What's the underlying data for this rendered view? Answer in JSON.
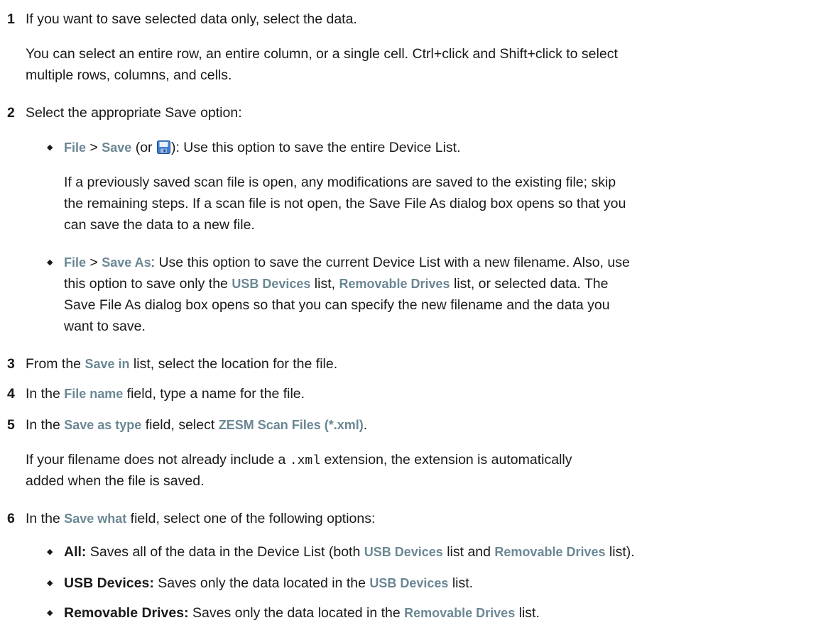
{
  "steps": [
    {
      "number": "1",
      "text": "If you want to save selected data only, select the data.",
      "note_line1": "You can select an entire row, an entire column, or a single cell. Ctrl+click and Shift+click to select",
      "note_line2": "multiple rows, columns, and cells."
    },
    {
      "number": "2",
      "text": "Select the appropriate Save option:",
      "bullets": [
        {
          "menu": "File",
          "sep": " > ",
          "item": "Save",
          "paren_open": " (or ",
          "icon": "save-icon",
          "rest": "): Use this option to save the entire Device List.",
          "note_lines": [
            "If a previously saved scan file is open, any modifications are saved to the existing file; skip",
            "the remaining steps. If a scan file is not open, the Save File As dialog box opens so that you",
            "can save the data to a new file."
          ]
        },
        {
          "menu": "File",
          "sep": " > ",
          "item": "Save As",
          "rest1": ": Use this option to save the current Device List with a new filename. Also, use",
          "line2_a": "this option to save only the ",
          "line2_ui1": "USB Devices",
          "line2_b": " list, ",
          "line2_ui2": "Removable Drives",
          "line2_c": " list, or selected data. The",
          "line3": "Save File As dialog box opens so that you can specify the new filename and the data you",
          "line4": "want to save."
        }
      ]
    },
    {
      "number": "3",
      "a": "From the ",
      "ui": "Save in",
      "b": " list, select the location for the file."
    },
    {
      "number": "4",
      "a": "In the ",
      "ui": "File name",
      "b": " field, type a name for the file."
    },
    {
      "number": "5",
      "a": "In the ",
      "ui": "Save as type",
      "b": " field, select ",
      "ui2": "ZESM Scan Files (*.xml)",
      "c": ".",
      "note_a": "If your filename does not already include a ",
      "note_code": ".xml",
      "note_b": " extension, the extension is automatically",
      "note_line2": "added when the file is saved."
    },
    {
      "number": "6",
      "a": "In the ",
      "ui": "Save what",
      "b": " field, select one of the following options:",
      "options": [
        {
          "term": "All:",
          "a": " Saves all of the data in the Device List (both ",
          "ui1": "USB Devices",
          "b": " list and ",
          "ui2": "Removable Drives",
          "c": " list)."
        },
        {
          "term": "USB Devices:",
          "a": " Saves only the data located in the ",
          "ui1": "USB Devices",
          "b": " list."
        },
        {
          "term": "Removable Drives:",
          "a": " Saves only the data located in the ",
          "ui1": "Removable Drives",
          "b": " list."
        }
      ]
    }
  ],
  "bullet_glyph": "◆",
  "colors": {
    "ui_term": "#6b8794",
    "text": "#1a1a1a"
  }
}
